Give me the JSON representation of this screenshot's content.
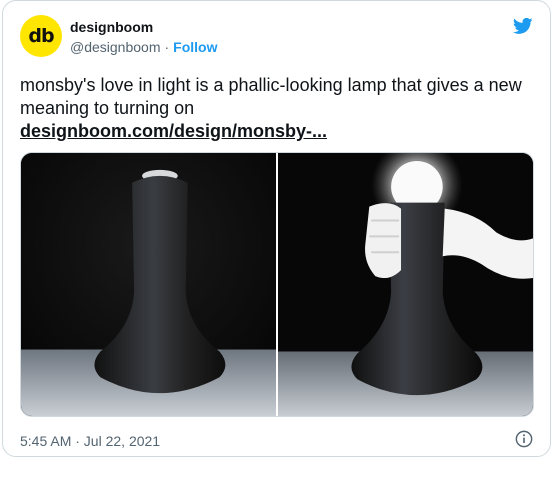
{
  "colors": {
    "accent": "#1d9bf0",
    "brand_yellow": "#ffe600",
    "text": "#0f1419",
    "muted": "#536471"
  },
  "author": {
    "avatar_text": "db",
    "name": "designboom",
    "handle": "@designboom",
    "separator": "·",
    "follow_label": "Follow"
  },
  "tweet": {
    "text": "monsby's love in light is a phallic-looking lamp that gives a new meaning to turning on",
    "link": "designboom.com/design/monsby-..."
  },
  "media": {
    "images": [
      {
        "icon": "lamp-off-photo"
      },
      {
        "icon": "lamp-glowing-gloved-hand-photo"
      }
    ]
  },
  "timestamp": "5:45 AM · Jul 22, 2021",
  "icons": {
    "twitter": "twitter-bird-icon",
    "info": "info-icon"
  }
}
